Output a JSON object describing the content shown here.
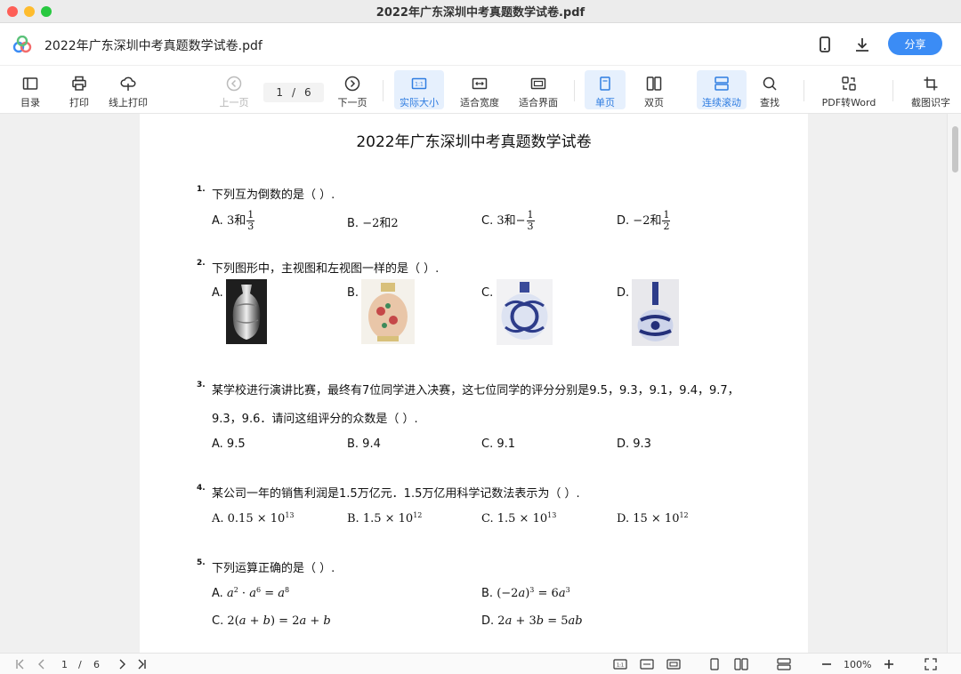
{
  "window": {
    "title": "2022年广东深圳中考真题数学试卷.pdf"
  },
  "header": {
    "doc_title": "2022年广东深圳中考真题数学试卷.pdf",
    "share_label": "分享"
  },
  "toolbar": {
    "toc": "目录",
    "print": "打印",
    "online_print": "线上打印",
    "prev": "上一页",
    "next": "下一页",
    "page_current": "1",
    "page_sep": "/",
    "page_total": "6",
    "actual_size": "实际大小",
    "fit_width": "适合宽度",
    "fit_window": "适合界面",
    "single": "单页",
    "double": "双页",
    "continuous": "连续滚动",
    "find": "查找",
    "pdf_to_word": "PDF转Word",
    "ocr": "截图识字"
  },
  "paper": {
    "title": "2022年广东深圳中考真题数学试卷",
    "q1": {
      "num": "1.",
      "text": "下列互为倒数的是（ ）.",
      "a": "A.",
      "a_int": "3和",
      "a_num": "1",
      "a_den": "3",
      "b": "B.",
      "b_val": "−2和2",
      "c": "C.",
      "c_int": "3和−",
      "c_num": "1",
      "c_den": "3",
      "d": "D.",
      "d_int": "−2和",
      "d_num": "1",
      "d_den": "2"
    },
    "q2": {
      "num": "2.",
      "text": "下列图形中，主视图和左视图一样的是（ ）.",
      "a": "A.",
      "b": "B.",
      "c": "C.",
      "d": "D."
    },
    "q3": {
      "num": "3.",
      "line1": "某学校进行演讲比赛，最终有7位同学进入决赛，这七位同学的评分分别是9.5，9.3，9.1，9.4，9.7，",
      "line2": "9.3，9.6．请问这组评分的众数是（ ）.",
      "a": "A. 9.5",
      "b": "B. 9.4",
      "c": "C. 9.1",
      "d": "D. 9.3"
    },
    "q4": {
      "num": "4.",
      "text": "某公司一年的销售利润是1.5万亿元．1.5万亿用科学记数法表示为（ ）.",
      "a": "A. 0.15 × 10",
      "a_exp": "13",
      "b": "B. 1.5 × 10",
      "b_exp": "12",
      "c": "C. 1.5 × 10",
      "c_exp": "13",
      "d": "D. 15 × 10",
      "d_exp": "12"
    },
    "q5": {
      "num": "5.",
      "text": "下列运算正确的是（ ）.",
      "a": "A.",
      "b": "B.",
      "c": "C.",
      "d": "D."
    }
  },
  "statusbar": {
    "page_current": "1",
    "page_sep": "/",
    "page_total": "6",
    "zoom": "100%"
  },
  "colors": {
    "accent": "#3b8cf5",
    "active_bg": "#e6f0fd"
  }
}
